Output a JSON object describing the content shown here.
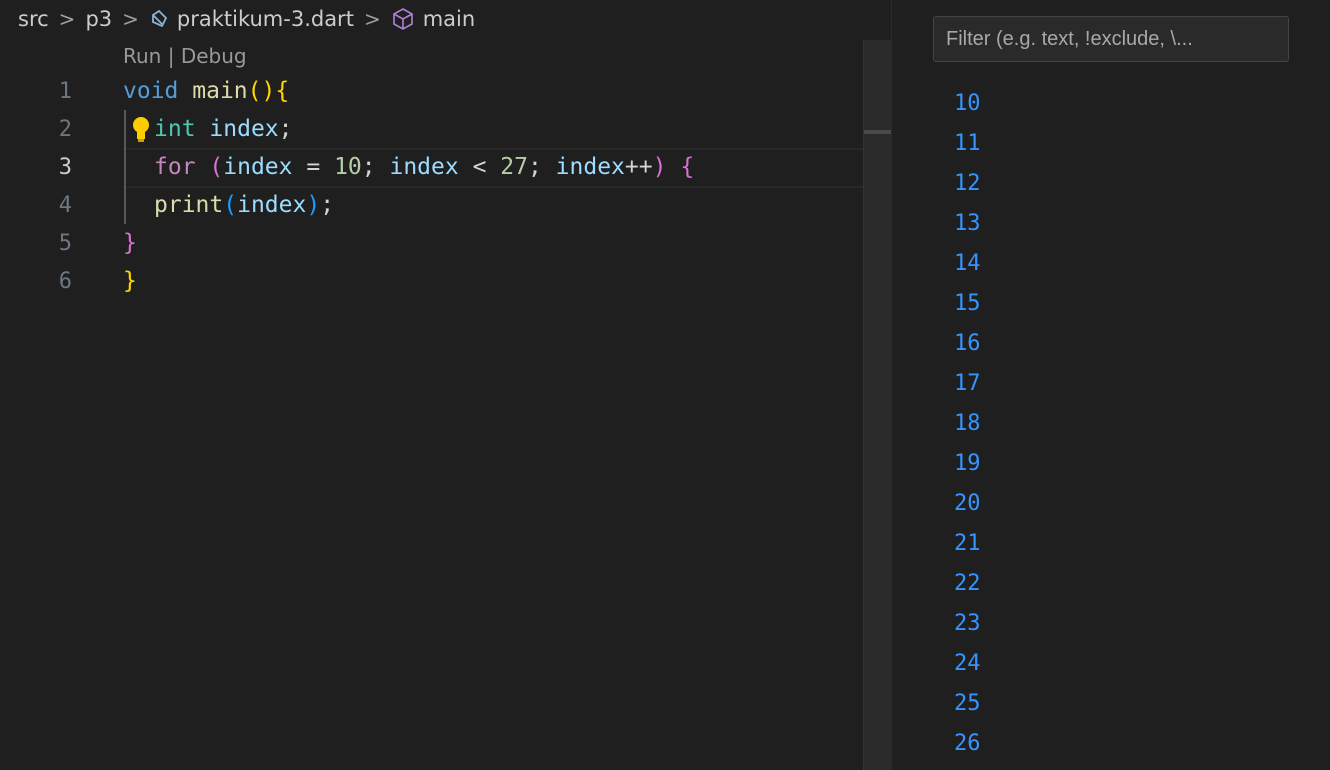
{
  "breadcrumb": {
    "items": [
      "src",
      "p3",
      "praktikum-3.dart",
      "main"
    ],
    "separator": ">"
  },
  "codelens": {
    "run": "Run",
    "separator": " | ",
    "debug": "Debug"
  },
  "editor": {
    "line_numbers": [
      "1",
      "2",
      "3",
      "4",
      "5",
      "6"
    ],
    "lines": [
      [
        {
          "t": "void",
          "c": "kw"
        },
        {
          "t": " "
        },
        {
          "t": "main",
          "c": "fn"
        },
        {
          "t": "(",
          "c": "br1"
        },
        {
          "t": ")",
          "c": "br1"
        },
        {
          "t": "{",
          "c": "br1"
        }
      ],
      [
        {
          "t": "  "
        },
        {
          "t": "int",
          "c": "type"
        },
        {
          "t": " "
        },
        {
          "t": "index",
          "c": "var"
        },
        {
          "t": ";"
        }
      ],
      [
        {
          "t": "  "
        },
        {
          "t": "for",
          "c": "ctrl"
        },
        {
          "t": " "
        },
        {
          "t": "(",
          "c": "br2"
        },
        {
          "t": "index",
          "c": "var"
        },
        {
          "t": " = "
        },
        {
          "t": "10",
          "c": "num"
        },
        {
          "t": "; "
        },
        {
          "t": "index",
          "c": "var"
        },
        {
          "t": " < "
        },
        {
          "t": "27",
          "c": "num"
        },
        {
          "t": "; "
        },
        {
          "t": "index",
          "c": "var"
        },
        {
          "t": "++"
        },
        {
          "t": ")",
          "c": "br2"
        },
        {
          "t": " "
        },
        {
          "t": "{",
          "c": "br2"
        }
      ],
      [
        {
          "t": "  "
        },
        {
          "t": "print",
          "c": "fn"
        },
        {
          "t": "(",
          "c": "br3"
        },
        {
          "t": "index",
          "c": "var"
        },
        {
          "t": ")",
          "c": "br3"
        },
        {
          "t": ";"
        }
      ],
      [
        {
          "t": "}",
          "c": "br2"
        }
      ],
      [
        {
          "t": "}",
          "c": "br1"
        }
      ]
    ],
    "active_line": 3
  },
  "panel": {
    "filter_placeholder": "Filter (e.g. text, !exclude, \\...",
    "output": [
      "10",
      "11",
      "12",
      "13",
      "14",
      "15",
      "16",
      "17",
      "18",
      "19",
      "20",
      "21",
      "22",
      "23",
      "24",
      "25",
      "26"
    ]
  },
  "colors": {
    "background": "#1f1f1f",
    "output_text": "#3794ff",
    "keyword": "#569cd6",
    "control": "#c586c0",
    "function": "#dcdcaa",
    "variable": "#9cdcfe",
    "type": "#4ec9b0",
    "number": "#b5cea8",
    "lightbulb": "#ffcc00"
  }
}
